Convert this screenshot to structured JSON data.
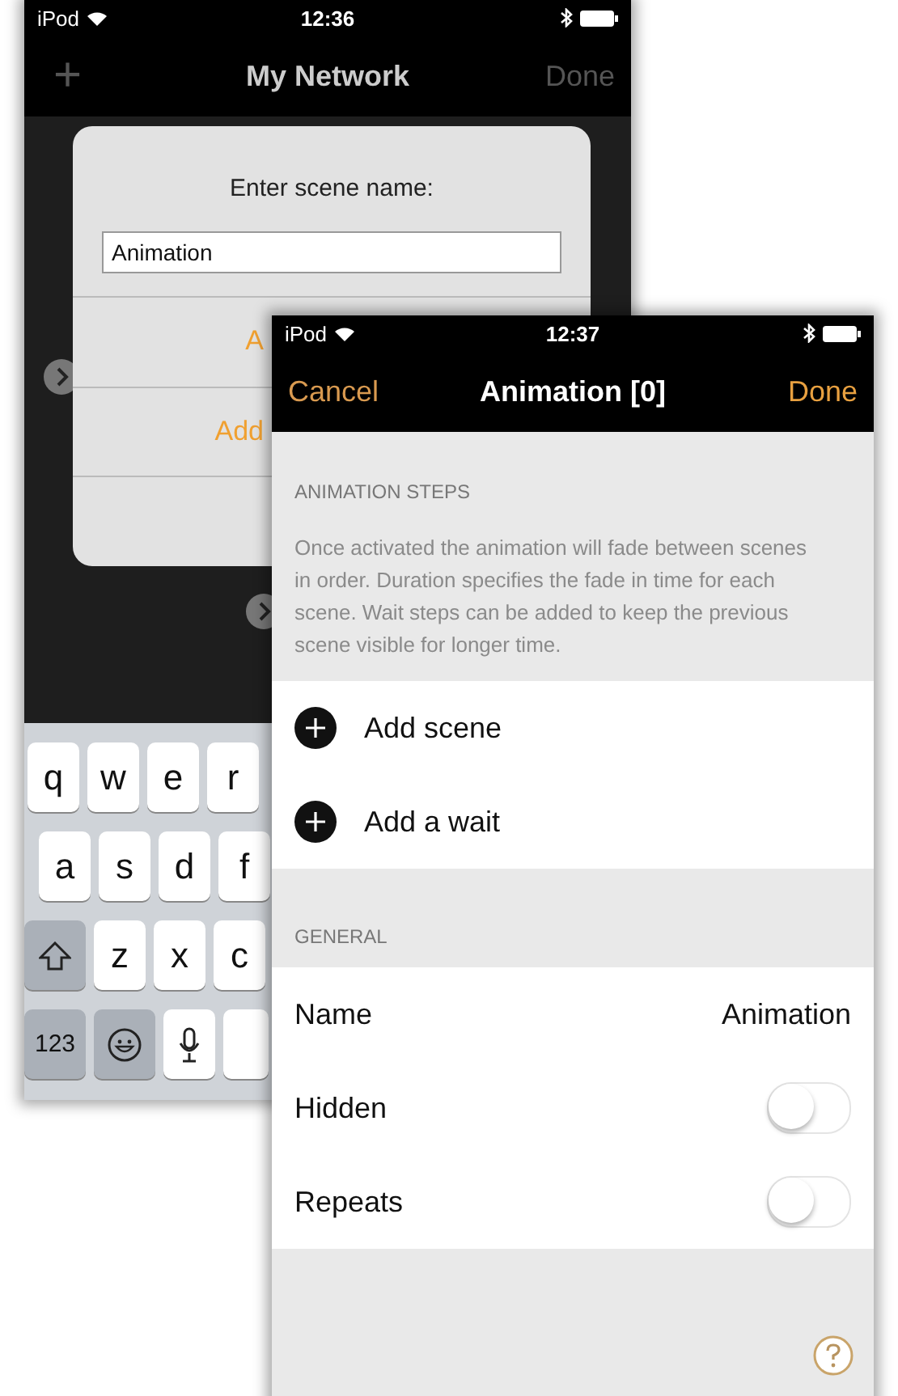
{
  "back_screen": {
    "status_bar": {
      "carrier": "iPod",
      "time": "12:36"
    },
    "nav_bar": {
      "left": "+",
      "title": "My Network",
      "right": "Done",
      "right_disabled": true
    },
    "dialog": {
      "title": "Enter scene name:",
      "input_value": "Animation",
      "buttons": [
        "A",
        "Add"
      ]
    },
    "keyboard": {
      "rows": [
        [
          {
            "kind": "letter",
            "label": "q"
          },
          {
            "kind": "letter",
            "label": "w"
          },
          {
            "kind": "letter",
            "label": "e"
          },
          {
            "kind": "letter",
            "label": "r"
          }
        ],
        [
          {
            "kind": "letter",
            "label": "a"
          },
          {
            "kind": "letter",
            "label": "s"
          },
          {
            "kind": "letter",
            "label": "d"
          },
          {
            "kind": "letter",
            "label": "f"
          }
        ],
        [
          {
            "kind": "shift"
          },
          {
            "kind": "letter",
            "label": "z"
          },
          {
            "kind": "letter",
            "label": "x"
          },
          {
            "kind": "letter",
            "label": "c"
          }
        ],
        [
          {
            "kind": "function",
            "label": "123"
          },
          {
            "kind": "emoji"
          },
          {
            "kind": "mic"
          },
          {
            "kind": "space"
          }
        ]
      ]
    }
  },
  "front_screen": {
    "status_bar": {
      "carrier": "iPod",
      "time": "12:37"
    },
    "nav_bar": {
      "left": "Cancel",
      "title": "Animation [0]",
      "right": "Done",
      "right_disabled": false
    },
    "sections": [
      {
        "header": "ANIMATION STEPS",
        "note": "Once activated the animation will fade between scenes in order. Duration specifies the fade in time for each scene. Wait steps can be added to keep the previous scene visible for longer time.",
        "rows": [
          {
            "kind": "add",
            "label": "Add scene"
          },
          {
            "kind": "add",
            "label": "Add a wait"
          }
        ]
      },
      {
        "header": "GENERAL",
        "rows": [
          {
            "kind": "value",
            "label": "Name",
            "value": "Animation"
          },
          {
            "kind": "toggle",
            "label": "Hidden",
            "on": false
          },
          {
            "kind": "toggle",
            "label": "Repeats",
            "on": false
          }
        ]
      }
    ]
  }
}
